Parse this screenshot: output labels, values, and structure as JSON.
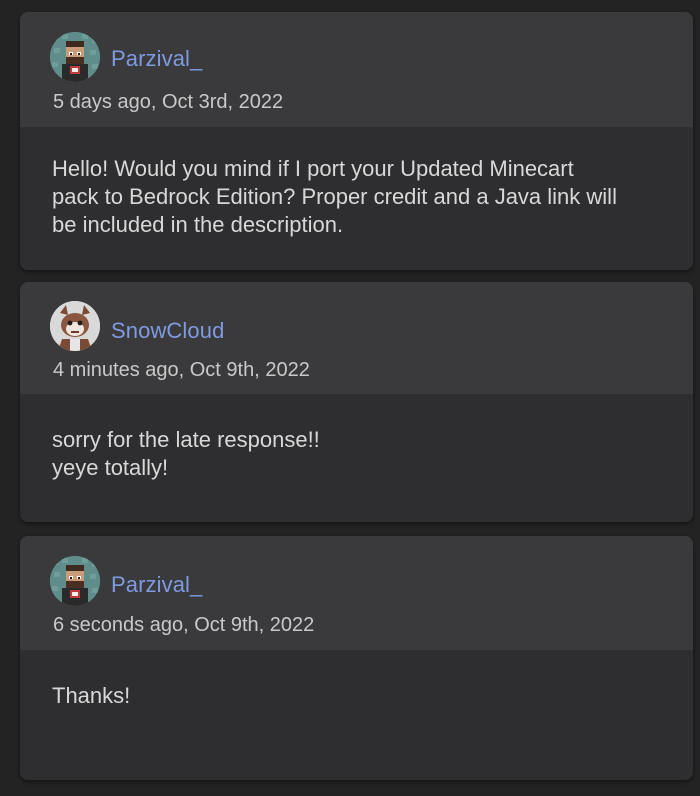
{
  "comments": [
    {
      "username": "Parzival_",
      "timestamp": "5 days ago, Oct 3rd, 2022",
      "message": "Hello! Would you mind if I port your Updated Minecart\npack to Bedrock Edition? Proper credit and a Java link will\nbe included in the description.",
      "avatar_icon": "pixel-character-avatar-icon"
    },
    {
      "username": "SnowCloud",
      "timestamp": "4 minutes ago, Oct 9th, 2022",
      "message": "sorry for the late response!!\nyeye totally!",
      "avatar_icon": "cartoon-character-avatar-icon"
    },
    {
      "username": "Parzival_",
      "timestamp": "6 seconds ago, Oct 9th, 2022",
      "message": "Thanks!",
      "avatar_icon": "pixel-character-avatar-icon"
    }
  ],
  "colors": {
    "page_background": "#232323",
    "header_background": "#3a3a3c",
    "body_background": "#2e2e30",
    "username": "#7f9be0",
    "timestamp": "#c9c9c9",
    "message": "#d8d8d8"
  }
}
